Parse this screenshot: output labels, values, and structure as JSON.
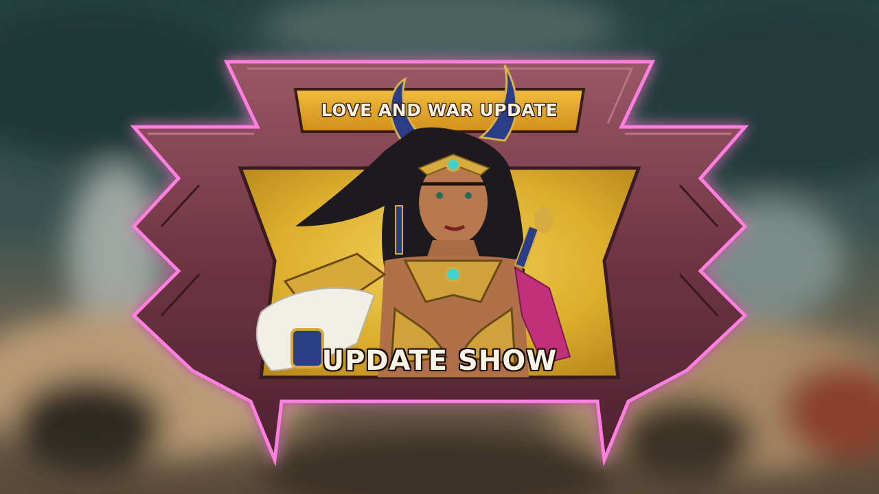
{
  "banner": {
    "title": "LOVE AND WAR UPDATE",
    "subtitle": "UPDATE SHOW"
  },
  "colors": {
    "frame_glow": "#ff6fd8",
    "frame_metal": "#7a3b4a",
    "panel_gold": "#e3b42e",
    "title_plate": "#e8a92a"
  },
  "icons": {
    "character": "goddess-character-art"
  }
}
